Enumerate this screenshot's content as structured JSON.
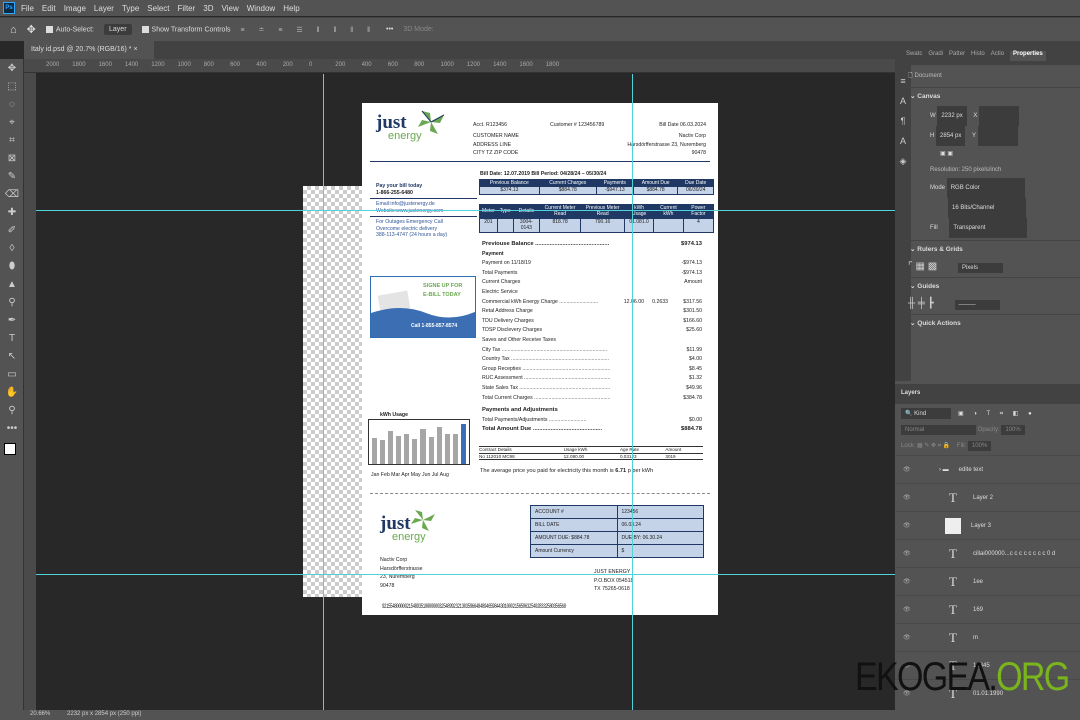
{
  "app": {
    "menu": [
      "File",
      "Edit",
      "Image",
      "Layer",
      "Type",
      "Select",
      "Filter",
      "3D",
      "View",
      "Window",
      "Help"
    ],
    "options": {
      "auto_select": "Auto-Select:",
      "layer_select": "Layer",
      "show_transform": "Show Transform Controls",
      "mode3d": "3D Mode:"
    },
    "doc_tab": "Italy id.psd @ 20.7% (RGB/16) *",
    "ruler": [
      "2000",
      "1800",
      "1600",
      "1400",
      "1200",
      "1000",
      "800",
      "600",
      "400",
      "200",
      "0",
      "200",
      "400",
      "600",
      "800",
      "1000",
      "1200",
      "1400",
      "1600",
      "1800"
    ],
    "status": {
      "zoom": "20.66%",
      "size": "2232 px x 2854 px (250 ppi)"
    }
  },
  "panels": {
    "tabs": [
      "Swatc",
      "Gradi",
      "Patter",
      "Histo",
      "Actio",
      "Properties"
    ],
    "doc_label": "Document",
    "canvas": "Canvas",
    "w_label": "W",
    "w": "2232 px",
    "h_label": "H",
    "h": "2854 px",
    "x_label": "X",
    "y_label": "Y",
    "resolution": "Resolution: 250 pixels/inch",
    "mode_label": "Mode",
    "mode": "RGB Color",
    "depth": "16 Bits/Channel",
    "fill_label": "Fill",
    "fill": "Transparent",
    "rulers": "Rulers & Grids",
    "units": "Pixels",
    "guides": "Guides",
    "quick": "Quick Actions",
    "layers_tab": "Layers",
    "kind": "Kind",
    "blend": "Normal",
    "opacity_label": "Opacity:",
    "opacity": "100%",
    "lock_label": "Lock:",
    "fill2_label": "Fill:",
    "fill2": "100%",
    "layers": [
      {
        "name": "edite text",
        "type": "group"
      },
      {
        "name": "Layer 2",
        "type": "text"
      },
      {
        "name": "Layer 3",
        "type": "image"
      },
      {
        "name": "cillai000000...c c c c c c c c 0 d",
        "type": "text"
      },
      {
        "name": "1ee",
        "type": "text"
      },
      {
        "name": "169",
        "type": "text"
      },
      {
        "name": "m",
        "type": "text"
      },
      {
        "name": "12345",
        "type": "text"
      },
      {
        "name": "01.01.1990",
        "type": "text"
      }
    ]
  },
  "bill": {
    "logo": {
      "just": "just",
      "energy": "energy"
    },
    "acct": "Acct. R123456",
    "customer_no": "Customer # 123456789",
    "bill_date_top": "Bill Date 06.03.2024",
    "customer": [
      "CUSTOMER NAME",
      "ADDRESS LINE",
      "CITY TZ ZIP CODE"
    ],
    "company": [
      "Nactiv Corp",
      "Harsdörfferstrasse 23,  Nuremberg",
      "90478"
    ],
    "bill_line": "Bill Date: 12.07.2019    Bill Period: 04/28/24 – 05/30/24",
    "summary": {
      "headers": [
        "Previous Balance",
        "Current Charges",
        "Payments",
        "Amount Due",
        "Due Date"
      ],
      "values": [
        "$374.13",
        "$884.78",
        "-$947.13",
        "$884.78",
        "06/30/24"
      ]
    },
    "meter": {
      "headers": [
        "Meter",
        "Type",
        "Details",
        "Current Meter Read",
        "Previous Meter Read",
        "kWh Usage",
        "Current kWh",
        "Power Factor"
      ],
      "values": [
        "201",
        "",
        "3004-0143",
        "818.78",
        "790.16",
        "01.081.0",
        "",
        "4"
      ]
    },
    "left": {
      "pay": "Pay your bill today",
      "phone": "1-866-255-6480",
      "email": "Email:info@justenergy.de",
      "website": "Website:www.justenergy.com",
      "outage": [
        "For Outages Emergency Call",
        "Overcome electric delivery",
        "388-113-4747 (24 hours a day)"
      ]
    },
    "signup": {
      "line1": "SIGNE UP FOR",
      "line2": "E-BILL TODAY",
      "call": "Call 1-855-857-8574"
    },
    "charges": [
      {
        "label": "Previouse Balance ..............................................",
        "amount": "$974.13",
        "bold": true
      },
      {
        "label": "Payment",
        "amount": "",
        "bold": true
      },
      {
        "label": "Payment on 11/18/19",
        "amount": "-$974.13"
      },
      {
        "label": "Total Payments",
        "amount": "-$974.13"
      },
      {
        "label": "Current Charges",
        "amount": "Amount"
      },
      {
        "label": "Electric Service",
        "amount": ""
      },
      {
        "label": "Commercial kWh Energy Charge ...........................",
        "r1": "12.06.00",
        "r2": "0.2633",
        "amount": "$317.56"
      },
      {
        "label": "Retal Address Charge",
        "amount": "$301.50"
      },
      {
        "label": "TDU Delivery Charges",
        "amount": "$166.60"
      },
      {
        "label": "TDSP Disclevery Charges",
        "amount": "$25.60"
      },
      {
        "label": "Saves and Other Receive Taxes",
        "amount": ""
      },
      {
        "label": "City Tax .........................................................................",
        "amount": "$11.99"
      },
      {
        "label": "Country Tax ....................................................................",
        "amount": "$4.00"
      },
      {
        "label": "Group Recepties ...............................................................",
        "amount": "$8.45"
      },
      {
        "label": "RUC Assessment ..............................................................",
        "amount": "$1.32"
      },
      {
        "label": "State Sales Tax ................................................................",
        "amount": "$49.96"
      },
      {
        "label": "Total Current Charges ......................................................",
        "amount": "$384.78"
      },
      {
        "label": "Payments and Adjustments",
        "amount": "",
        "bold": true
      },
      {
        "label": "Total Payments/Adjustments ..........................",
        "amount": "$0.00"
      },
      {
        "label": "Total Amount Due ...........................................",
        "amount": "$884.78",
        "bold": true
      }
    ],
    "usage": {
      "title": "kWh Usage",
      "months": "Jan Feb Mar Apr May Jun Jul Aug",
      "values": [
        60,
        55,
        75,
        65,
        70,
        58,
        80,
        62,
        85,
        70,
        68,
        92
      ]
    },
    "contract": {
      "headers": [
        "Contract Details",
        "Usage kWh",
        "Age Rate",
        "Amount"
      ],
      "values": [
        "No 112010 MC98",
        "12.080.00",
        "0.03123",
        "3019"
      ]
    },
    "avg_price_pre": "The average price  you paid for electricity this month is ",
    "avg_price_val": "6.71",
    "avg_price_post": " p per kWh",
    "stub": {
      "rows": [
        [
          "ACCOUNT #",
          "123456"
        ],
        [
          "BILL DATE",
          "06.03.24"
        ],
        [
          "AMOUNT DUE: $884.78",
          "DUE BY: 06.30.24"
        ],
        [
          "Amount Currency",
          "$"
        ]
      ],
      "customer": [
        "Nactiv Corp",
        "Harsdörfferstrasse",
        "23,  Nuremberg",
        "90478"
      ],
      "remit": [
        "JUST ENERGY",
        "P.O.BOX 054518",
        "TX 75265-0618"
      ],
      "barcode": "9215548000002154893510000000325489923213035966484894659844301000215659632540283325803565​68"
    }
  },
  "watermark": {
    "a": "EKOGEA.",
    "b": "ORG"
  },
  "colors": {
    "navy": "#1f3864",
    "light_blue": "#c5d3e8",
    "green": "#6aa84f",
    "guide": "#4fd3d8"
  }
}
